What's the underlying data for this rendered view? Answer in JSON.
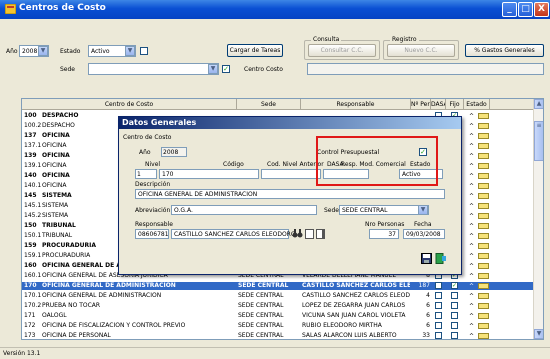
{
  "window": {
    "title": "Centros de Costo",
    "min": "_",
    "max": "□",
    "close": "X"
  },
  "toolbar": {
    "anio_label": "Año",
    "anio_value": "2008",
    "estado_label": "Estado",
    "estado_value": "Activo",
    "sede_label": "Sede",
    "sede_value": "",
    "centro_costo_label": "Centro Costo",
    "centro_costo_value": "",
    "cargar_button": "Cargar de Tareas",
    "consulta_group": "Consulta",
    "consulta_button": "Consultar C.C.",
    "registro_group": "Registro",
    "registro_button": "Nuevo C.C.",
    "gastos_button": "% Gastos Generales"
  },
  "grid": {
    "columns": [
      "Centro de Costo",
      "Sede",
      "Responsable",
      "Nº Pers",
      "DASA",
      "Fijo",
      "Estado"
    ],
    "rows": [
      {
        "code": "100",
        "desc": "DESPACHO",
        "sede": "",
        "resp": "",
        "n": "",
        "bold": true,
        "sel": false
      },
      {
        "code": "100.2",
        "desc": "DESPACHO",
        "sede": "",
        "resp": "",
        "n": "",
        "bold": false,
        "sel": false
      },
      {
        "code": "137",
        "desc": "OFICINA",
        "sede": "",
        "resp": "",
        "n": "",
        "bold": true,
        "sel": false
      },
      {
        "code": "137.1",
        "desc": "OFICINA",
        "sede": "",
        "resp": "",
        "n": "",
        "bold": false,
        "sel": false
      },
      {
        "code": "139",
        "desc": "OFICINA",
        "sede": "",
        "resp": "",
        "n": "",
        "bold": true,
        "sel": false
      },
      {
        "code": "139.1",
        "desc": "OFICINA",
        "sede": "",
        "resp": "",
        "n": "",
        "bold": false,
        "sel": false
      },
      {
        "code": "140",
        "desc": "OFICINA",
        "sede": "",
        "resp": "",
        "n": "",
        "bold": true,
        "sel": false
      },
      {
        "code": "140.1",
        "desc": "OFICINA",
        "sede": "",
        "resp": "",
        "n": "",
        "bold": false,
        "sel": false
      },
      {
        "code": "145",
        "desc": "SISTEMA",
        "sede": "",
        "resp": "",
        "n": "",
        "bold": true,
        "sel": false
      },
      {
        "code": "145.1",
        "desc": "SISTEMA",
        "sede": "",
        "resp": "",
        "n": "",
        "bold": false,
        "sel": false
      },
      {
        "code": "145.2",
        "desc": "SISTEMA",
        "sede": "",
        "resp": "",
        "n": "",
        "bold": false,
        "sel": false
      },
      {
        "code": "150",
        "desc": "TRIBUNAL",
        "sede": "",
        "resp": "",
        "n": "",
        "bold": true,
        "sel": false
      },
      {
        "code": "150.1",
        "desc": "TRIBUNAL",
        "sede": "",
        "resp": "",
        "n": "",
        "bold": false,
        "sel": false
      },
      {
        "code": "159",
        "desc": "PROCURADURIA",
        "sede": "",
        "resp": "",
        "n": "",
        "bold": true,
        "sel": false
      },
      {
        "code": "159.1",
        "desc": "PROCURADURIA",
        "sede": "",
        "resp": "",
        "n": "",
        "bold": false,
        "sel": false
      },
      {
        "code": "160",
        "desc": "OFICINA GENERAL DE ASESORIA JURIDICA",
        "sede": "SEDE CENTRAL",
        "resp": "VELARDE DELLEPIANE MANUEL",
        "n": "",
        "bold": true,
        "sel": false
      },
      {
        "code": "160.1",
        "desc": "OFICINA GENERAL DE ASESORIA JURIDICA",
        "sede": "SEDE CENTRAL",
        "resp": "VELARDE DELLEPIANE MANUEL",
        "n": "8",
        "bold": false,
        "sel": false
      },
      {
        "code": "170",
        "desc": "OFICINA GENERAL DE ADMINISTRACION",
        "sede": "SEDE CENTRAL",
        "resp": "CASTILLO SANCHEZ CARLOS ELEODORO",
        "n": "187",
        "bold": true,
        "sel": true
      },
      {
        "code": "170.1",
        "desc": "OFICINA GENERAL DE ADMINISTRACION",
        "sede": "SEDE CENTRAL",
        "resp": "CASTILLO SANCHEZ CARLOS ELEODORO",
        "n": "4",
        "bold": false,
        "sel": false
      },
      {
        "code": "170.2",
        "desc": "PRUEBA NO TOCAR",
        "sede": "SEDE CENTRAL",
        "resp": "LOPEZ DE ZEGARRA JUAN CARLOS",
        "n": "6",
        "bold": false,
        "sel": false
      },
      {
        "code": "171",
        "desc": "OALOGL",
        "sede": "SEDE CENTRAL",
        "resp": "VICUÑA SAN JUAN CAROL VIOLETA",
        "n": "6",
        "bold": false,
        "sel": false
      },
      {
        "code": "172",
        "desc": "OFICINA DE FISCALIZACION Y CONTROL PREVIO",
        "sede": "SEDE CENTRAL",
        "resp": "RUBIO ELEODORO MIRTHA",
        "n": "6",
        "bold": false,
        "sel": false
      },
      {
        "code": "173",
        "desc": "OFICINA DE PERSONAL",
        "sede": "SEDE CENTRAL",
        "resp": "SALAS ALARCON LUIS ALBERTO",
        "n": "33",
        "bold": false,
        "sel": false
      }
    ],
    "fijo_checked_rows": [
      0,
      2,
      4,
      5,
      8,
      9,
      11,
      13,
      15,
      16,
      17
    ],
    "estado_symbol": "^"
  },
  "dialog": {
    "title": "Datos Generales",
    "group_label": "Centro de Costo",
    "anio_label": "Año",
    "anio_value": "2008",
    "nivel_label": "Nivel",
    "nivel_value": "1",
    "codigo_label": "Código",
    "codigo_value": "170",
    "cod_anterior_label": "Cod. Nivel Anterior",
    "cod_anterior_value": "",
    "dasa_label": "DASA",
    "dasa_value": "",
    "presupuestal_label": "Control Presupuestal",
    "presupuestal_checked": true,
    "resp_label": "Resp. Mod. Comercial",
    "estado_label": "Estado",
    "estado_value": "Activo",
    "descripcion_label": "Descripción",
    "descripcion_value": "OFICINA GENERAL DE ADMINISTRACION",
    "abreviacion_label": "Abreviación",
    "abreviacion_value": "O.G.A.",
    "sede_label": "Sede",
    "sede_value": "SEDE CENTRAL",
    "responsable_label": "Responsable",
    "responsable_code": "08606781",
    "responsable_name": "CASTILLO SANCHEZ CARLOS ELEODORO",
    "nro_personas_label": "Nro Personas",
    "nro_personas_value": "37",
    "fecha_label": "Fecha",
    "fecha_value": "09/03/2008"
  },
  "status": {
    "text": "Versión 13.1"
  },
  "colors": {
    "title_blue": "#0a4fd3",
    "highlight_red": "#e01818",
    "selection_blue": "#3169c6"
  }
}
